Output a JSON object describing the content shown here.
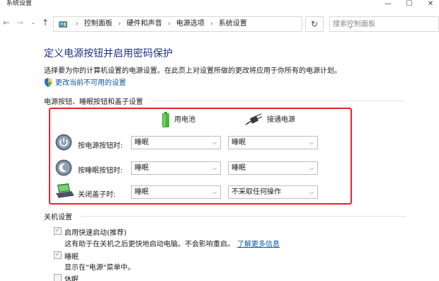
{
  "window": {
    "title": "系统设置",
    "min_glyph": "—",
    "max_glyph": "☐",
    "close_glyph": "✕"
  },
  "nav": {
    "back_glyph": "←",
    "forward_glyph": "→",
    "recent_glyph": "⌄",
    "up_glyph": "↑",
    "refresh_glyph": "↻",
    "address_dropdown_glyph": "⌄",
    "breadcrumb_separator": "›",
    "breadcrumbs": [
      "控制面板",
      "硬件和声音",
      "电源选项",
      "系统设置"
    ],
    "search_placeholder": "搜索控制面板"
  },
  "page": {
    "title": "定义电源按钮并启用密码保护",
    "description": "选择要为你的计算机设置的电源设置。在此页上对设置所做的更改将应用于你所有的电源计划。",
    "change_link": "更改当前不可用的设置"
  },
  "buttons_section": {
    "heading": "电源按钮、睡眠按钮和盖子设置",
    "col_battery": "用电池",
    "col_plugged": "接通电源",
    "rows": [
      {
        "label": "按电源按钮时:",
        "battery": "睡眠",
        "plugged": "睡眠",
        "icon": "power-button-icon"
      },
      {
        "label": "按睡眠按钮时:",
        "battery": "睡眠",
        "plugged": "睡眠",
        "icon": "sleep-button-icon"
      },
      {
        "label": "关闭盖子时:",
        "battery": "睡眠",
        "plugged": "不采取任何操作",
        "icon": "laptop-lid-icon"
      }
    ]
  },
  "shutdown_section": {
    "heading": "关机设置",
    "fast_startup": {
      "label": "启用快速启动(推荐)",
      "desc": "这有助于在关机之后更快地启动电脑。不会影响重启。",
      "link": "了解更多信息",
      "checked": true
    },
    "sleep": {
      "label": "睡眠",
      "desc": "显示在\"电源\"菜单中。",
      "checked": true
    },
    "hibernate": {
      "label": "休眠",
      "checked": false
    },
    "check_glyph": "✓"
  },
  "colors": {
    "title_blue": "#1e3287",
    "link_blue": "#0a58a8",
    "highlight_red": "#e8222f"
  }
}
